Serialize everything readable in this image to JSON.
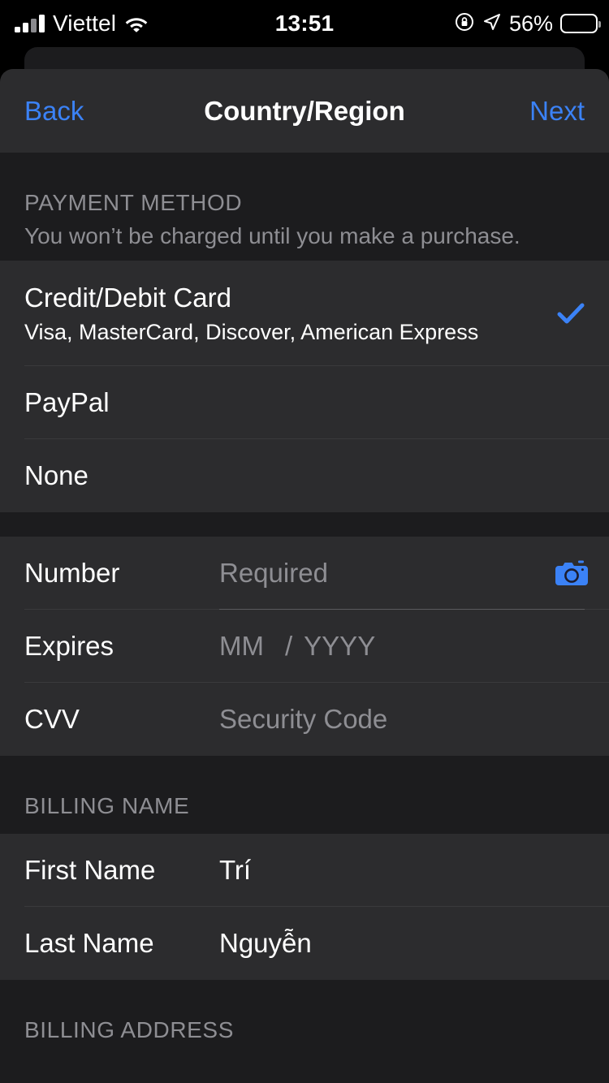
{
  "status_bar": {
    "carrier": "Viettel",
    "time": "13:51",
    "battery_percent": "56%",
    "signal_icon": "cellular-signal-icon",
    "wifi_icon": "wifi-icon",
    "rotation_lock_icon": "rotation-lock-icon",
    "location_icon": "location-arrow-icon",
    "battery_icon": "battery-icon",
    "battery_level": 56
  },
  "navbar": {
    "back_label": "Back",
    "title": "Country/Region",
    "next_label": "Next",
    "accent_color": "#3b82f6"
  },
  "payment_method": {
    "header": "PAYMENT METHOD",
    "subtitle": "You won’t be charged until you make a purchase.",
    "options": [
      {
        "label": "Credit/Debit Card",
        "detail": "Visa, MasterCard, Discover, American Express",
        "selected": true,
        "check_icon": "checkmark-icon"
      },
      {
        "label": "PayPal",
        "detail": "",
        "selected": false
      },
      {
        "label": "None",
        "detail": "",
        "selected": false
      }
    ]
  },
  "card_details": {
    "fields": [
      {
        "label": "Number",
        "value": "",
        "placeholder": "Required",
        "has_camera": true,
        "camera_icon": "camera-icon"
      },
      {
        "label": "Expires",
        "value": "",
        "placeholder_month": "MM",
        "placeholder_separator": "/",
        "placeholder_year": "YYYY",
        "has_camera": false
      },
      {
        "label": "CVV",
        "value": "",
        "placeholder": "Security Code",
        "has_camera": false
      }
    ]
  },
  "billing_name": {
    "header": "BILLING NAME",
    "fields": [
      {
        "label": "First Name",
        "value": "Trí"
      },
      {
        "label": "Last Name",
        "value": "Nguyễn"
      }
    ]
  },
  "billing_address": {
    "header": "BILLING ADDRESS"
  },
  "colors": {
    "accent": "#3b82f6",
    "sheet_background": "#1c1c1e",
    "row_background": "#2c2c2e",
    "separator": "#3a3a3c",
    "secondary_text": "#8e8e93",
    "primary_text": "#ffffff"
  }
}
